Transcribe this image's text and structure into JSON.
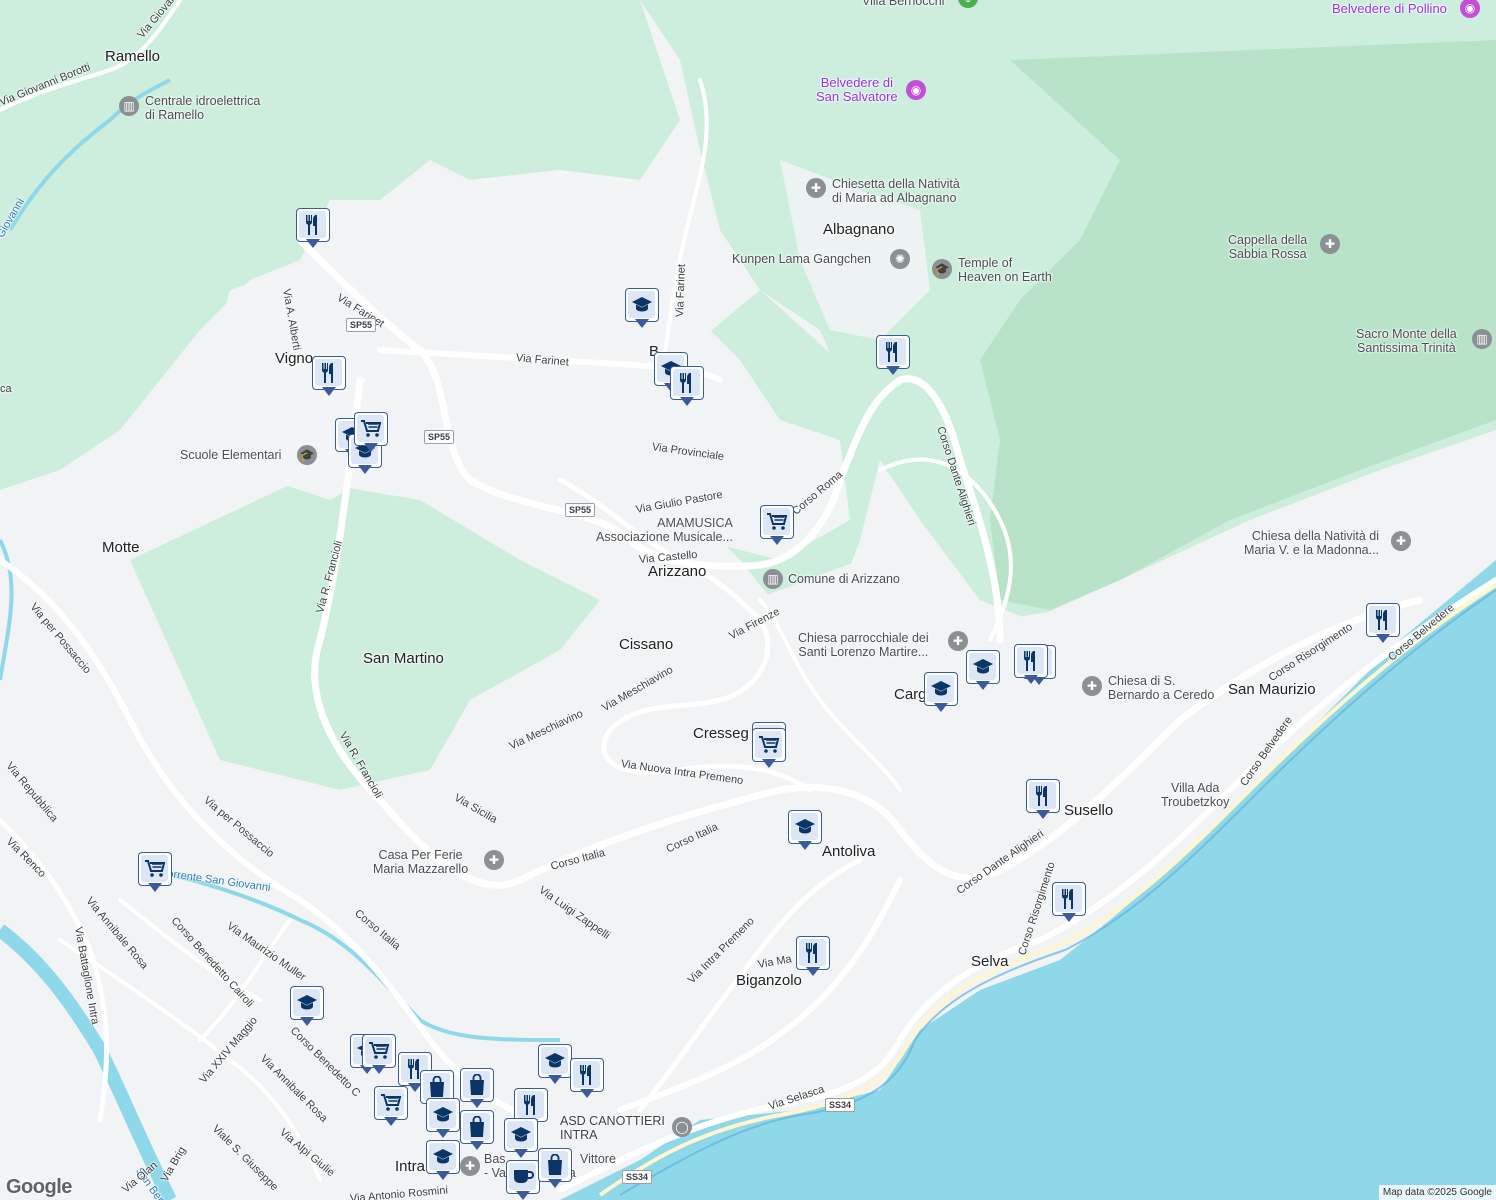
{
  "map": {
    "attribution": "Map data ©2025 Google",
    "logo": "Google",
    "colors": {
      "land": "#f1f3f4",
      "forest": "#cdeedd",
      "forest_dark": "#a8dcbb",
      "water": "#8fd8ea",
      "road": "#ffffff",
      "pin_border": "#3a5a9a",
      "pin_fill": "#dce6f5",
      "poi_gray": "#8b9095",
      "poi_purple": "#c14fd8"
    },
    "places": {
      "ramello": "Ramello",
      "motte": "Motte",
      "vignone": "Vigno",
      "san_martino": "San Martino",
      "arizzano": "Arizzano",
      "cissano": "Cissano",
      "cresseglio": "Cresseg",
      "albagnano": "Albagnano",
      "antoliva": "Antoliva",
      "biganzolo": "Biganzolo",
      "selva": "Selva",
      "susello": "Susello",
      "san_maurizio": "San Maurizio",
      "cargiago": "Carg",
      "intra": "Intra",
      "bee": "B"
    },
    "streets": {
      "via_giovanni_borotti": "Via Giovanni Borotti",
      "via_giovan": "Via Giovan",
      "via_farinet_1": "Via Farinet",
      "via_farinet_2": "Via Farinet",
      "via_farinet_3": "Via Farinet",
      "via_a_alberti": "Via A. Alberti",
      "via_provinciale": "Via Provinciale",
      "via_giulio_pastore": "Via Giulio Pastore",
      "corso_roma": "Corso Roma",
      "via_castello": "Via Castello",
      "via_firenze": "Via Firenze",
      "via_r_francioli_1": "Via R. Francioli",
      "via_r_francioli_2": "Via R. Francioli",
      "via_per_possaccio_1": "Via per Possaccio",
      "via_per_possaccio_2": "Via per Possaccio",
      "via_meschiavino_1": "Via Meschiavino",
      "via_meschiavino_2": "Via Meschiavino",
      "via_nuova_intra_premeno": "Via Nuova Intra Premeno",
      "via_sicilia": "Via Sicilia",
      "corso_italia_1": "Corso Italia",
      "corso_italia_2": "Corso Italia",
      "corso_italia_3": "Corso Italia",
      "via_luigi_zappelli": "Via Luigi Zappelli",
      "via_intra_premeno": "Via Intra Premeno",
      "via_ma": "Via Ma",
      "corso_dante_alighieri_1": "Corso Dante Alighieri",
      "corso_dante_alighieri_2": "Corso Dante Alighieri",
      "corso_risorgimento_1": "Corso Risorgimento",
      "corso_risorgimento_2": "Corso Risorgimento",
      "corso_belvedere_1": "Corso Belvedere",
      "corso_belvedere_2": "Corso Belvedere",
      "via_repubblica": "Via Repubblica",
      "via_renco": "Via Renco",
      "via_annibale_rosa_1": "Via Annibale Rosa",
      "via_annibale_rosa_2": "Via Annibale Rosa",
      "via_battaglione_intra": "Via Battaglione Intra",
      "corso_benedetto_cairoli_1": "Corso Benedetto Cairoli",
      "corso_benedetto_cairoli_2": "Corso Benedetto C",
      "via_maurizio_muller": "Via Maurizio Muller",
      "via_xxiv_maggio": "Via XXIV Maggio",
      "viale_s_giuseppe": "Viale S. Giuseppe",
      "via_alpi_giulie": "Via Alpi Giulie",
      "via_antonio_rosmini": "Via Antonio Rosmini",
      "via_selasca": "Via Selasca",
      "torrente_san_giovanni": "Torrente San Giovanni",
      "giovanni": "Giovanni",
      "san_ber": "San Ber",
      "via_olan": "Via Olan",
      "via_brig": "Via Brig",
      "ca": "ca"
    },
    "shields": [
      "SP55",
      "SP55",
      "SP55",
      "SS34",
      "SS34"
    ],
    "pois": {
      "villa_bernocchi": "Villa Bernocchi",
      "belvedere_pollino": "Belvedere di Pollino",
      "belvedere_san_salvatore": "Belvedere di\nSan Salvatore",
      "chiesetta": "Chiesetta della Natività\ndi Maria ad Albagnano",
      "kunpen": "Kunpen Lama Gangchen",
      "temple": "Temple of\nHeaven on Earth",
      "cappella": "Cappella della\nSabbia Rossa",
      "sacro_monte": "Sacro Monte della\nSantissima Trinità",
      "centrale": "Centrale idroelettrica\ndi Ramello",
      "scuole": "Scuole Elementari",
      "amamusica": "AMAMUSICA\nAssociazione Musicale...",
      "comune": "Comune di Arizzano",
      "chiesa_parrocchiale": "Chiesa parrocchiale dei\nSanti Lorenzo Martire...",
      "chiesa_nativita": "Chiesa della Natività di\nMaria V. e la Madonna...",
      "chiesa_bernardo": "Chiesa di S.\nBernardo a Ceredo",
      "villa_ada": "Villa Ada\nTroubetzkoy",
      "casa_ferie": "Casa Per Ferie\nMaria Mazzarello",
      "asd": "ASD CANOTTIERI\nINTRA",
      "basilica": "Bas",
      "vittore": "Vittore",
      "va": "- Va",
      "dia": "ia"
    },
    "markers": [
      {
        "type": "restaurant"
      },
      {
        "type": "school"
      },
      {
        "type": "school"
      },
      {
        "type": "restaurant"
      },
      {
        "type": "restaurant"
      },
      {
        "type": "grocery"
      },
      {
        "type": "school"
      },
      {
        "type": "school"
      },
      {
        "type": "grocery"
      },
      {
        "type": "restaurant"
      },
      {
        "type": "school"
      },
      {
        "type": "school"
      },
      {
        "type": "restaurant"
      },
      {
        "type": "restaurant"
      },
      {
        "type": "restaurant"
      },
      {
        "type": "grocery"
      },
      {
        "type": "grocery"
      },
      {
        "type": "school"
      },
      {
        "type": "restaurant"
      },
      {
        "type": "restaurant"
      },
      {
        "type": "restaurant"
      },
      {
        "type": "grocery"
      },
      {
        "type": "school"
      },
      {
        "type": "school"
      },
      {
        "type": "grocery"
      },
      {
        "type": "restaurant"
      },
      {
        "type": "shopping"
      },
      {
        "type": "shopping"
      },
      {
        "type": "grocery"
      },
      {
        "type": "school"
      },
      {
        "type": "restaurant"
      },
      {
        "type": "restaurant"
      },
      {
        "type": "shopping"
      },
      {
        "type": "school"
      },
      {
        "type": "cafe"
      },
      {
        "type": "shopping"
      },
      {
        "type": "school"
      },
      {
        "type": "school"
      }
    ]
  }
}
